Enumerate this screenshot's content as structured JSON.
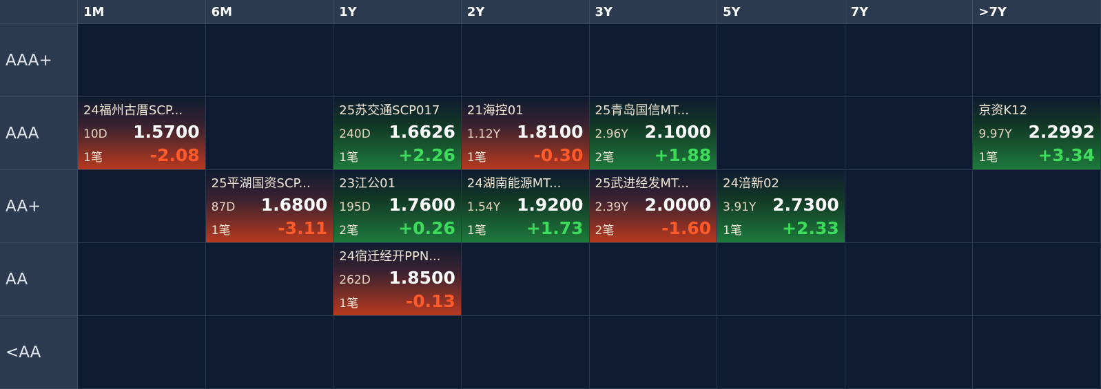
{
  "columns": [
    "1M",
    "6M",
    "1Y",
    "2Y",
    "3Y",
    "5Y",
    "7Y",
    ">7Y"
  ],
  "rows": [
    "AAA+",
    "AAA",
    "AA+",
    "AA",
    "<AA"
  ],
  "colors": {
    "up": "#3ddc5a",
    "down": "#ff5a2a",
    "header_bg": "#2c3a50",
    "cell_bg": "#0f1b30"
  },
  "bonds": [
    {
      "row": 1,
      "col": 0,
      "name": "24福州古厝SCP...",
      "term": "10D",
      "yield": "1.5700",
      "count": "1笔",
      "change": "-2.08",
      "dir": "down"
    },
    {
      "row": 1,
      "col": 2,
      "name": "25苏交通SCP017",
      "term": "240D",
      "yield": "1.6626",
      "count": "1笔",
      "change": "+2.26",
      "dir": "up"
    },
    {
      "row": 1,
      "col": 3,
      "name": "21海控01",
      "term": "1.12Y",
      "yield": "1.8100",
      "count": "1笔",
      "change": "-0.30",
      "dir": "down"
    },
    {
      "row": 1,
      "col": 4,
      "name": "25青岛国信MT...",
      "term": "2.96Y",
      "yield": "2.1000",
      "count": "2笔",
      "change": "+1.88",
      "dir": "up"
    },
    {
      "row": 1,
      "col": 7,
      "name": "京资K12",
      "term": "9.97Y",
      "yield": "2.2992",
      "count": "1笔",
      "change": "+3.34",
      "dir": "up"
    },
    {
      "row": 2,
      "col": 1,
      "name": "25平湖国资SCP...",
      "term": "87D",
      "yield": "1.6800",
      "count": "1笔",
      "change": "-3.11",
      "dir": "down"
    },
    {
      "row": 2,
      "col": 2,
      "name": "23江公01",
      "term": "195D",
      "yield": "1.7600",
      "count": "2笔",
      "change": "+0.26",
      "dir": "up"
    },
    {
      "row": 2,
      "col": 3,
      "name": "24湖南能源MT...",
      "term": "1.54Y",
      "yield": "1.9200",
      "count": "1笔",
      "change": "+1.73",
      "dir": "up"
    },
    {
      "row": 2,
      "col": 4,
      "name": "25武进经发MT...",
      "term": "2.39Y",
      "yield": "2.0000",
      "count": "2笔",
      "change": "-1.60",
      "dir": "down"
    },
    {
      "row": 2,
      "col": 5,
      "name": "24涪新02",
      "term": "3.91Y",
      "yield": "2.7300",
      "count": "1笔",
      "change": "+2.33",
      "dir": "up"
    },
    {
      "row": 3,
      "col": 2,
      "name": "24宿迁经开PPN...",
      "term": "262D",
      "yield": "1.8500",
      "count": "1笔",
      "change": "-0.13",
      "dir": "down"
    }
  ]
}
